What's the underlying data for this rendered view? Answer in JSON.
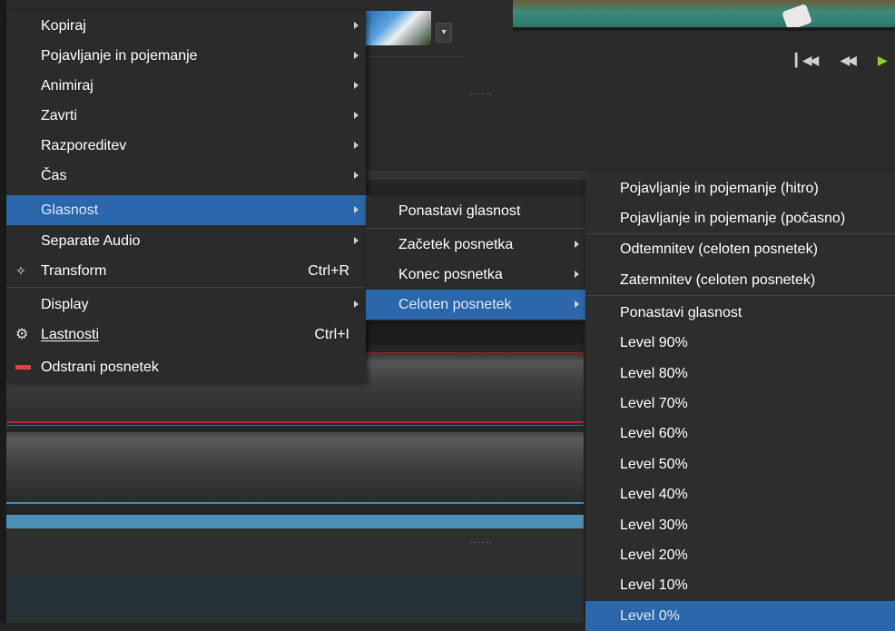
{
  "main_menu": {
    "items": [
      {
        "label": "Kopiraj",
        "shortcut": "",
        "submenu": true
      },
      {
        "label": "Pojavljanje in pojemanje",
        "shortcut": "",
        "submenu": true
      },
      {
        "label": "Animiraj",
        "shortcut": "",
        "submenu": true
      },
      {
        "label": "Zavrti",
        "shortcut": "",
        "submenu": true
      },
      {
        "label": "Razporeditev",
        "shortcut": "",
        "submenu": true
      },
      {
        "label": "Čas",
        "shortcut": "",
        "submenu": true
      },
      {
        "label": "Glasnost",
        "shortcut": "",
        "submenu": true,
        "highlighted": true
      },
      {
        "label": "Separate Audio",
        "shortcut": "",
        "submenu": true
      },
      {
        "label": "Transform",
        "shortcut": "Ctrl+R",
        "icon": "move-icon"
      },
      {
        "label": "Display",
        "shortcut": "",
        "submenu": true
      },
      {
        "label": "Lastnosti",
        "shortcut": "Ctrl+I",
        "icon": "gear-icon"
      },
      {
        "label": "Odstrani posnetek",
        "shortcut": "",
        "icon": "remove-icon"
      }
    ]
  },
  "submenu_glasnost": {
    "items": [
      {
        "label": "Ponastavi glasnost",
        "submenu": false
      },
      {
        "label": "Začetek posnetka",
        "submenu": true
      },
      {
        "label": "Konec posnetka",
        "submenu": true
      },
      {
        "label": "Celoten posnetek",
        "submenu": true,
        "highlighted": true
      }
    ]
  },
  "submenu_celoten": {
    "items": [
      {
        "label": "Pojavljanje in pojemanje (hitro)"
      },
      {
        "label": "Pojavljanje in pojemanje (počasno)"
      },
      {
        "label": "Odtemnitev (celoten posnetek)"
      },
      {
        "label": "Zatemnitev (celoten posnetek)"
      },
      {
        "label": "Ponastavi glasnost"
      },
      {
        "label": "Level 90%"
      },
      {
        "label": "Level 80%"
      },
      {
        "label": "Level 70%"
      },
      {
        "label": "Level 60%"
      },
      {
        "label": "Level 50%"
      },
      {
        "label": "Level 40%"
      },
      {
        "label": "Level 30%"
      },
      {
        "label": "Level 20%"
      },
      {
        "label": "Level 10%"
      },
      {
        "label": "Level 0%",
        "highlighted": true
      }
    ]
  },
  "transport": {
    "skip_back_icon": "skip-to-start-icon",
    "rewind_icon": "rewind-icon",
    "play_icon": "play-icon"
  },
  "colors": {
    "highlight": "#2b67aa",
    "menu_bg": "#2b2b2b",
    "play": "#8ed02a",
    "remove_icon": "#e04040"
  }
}
